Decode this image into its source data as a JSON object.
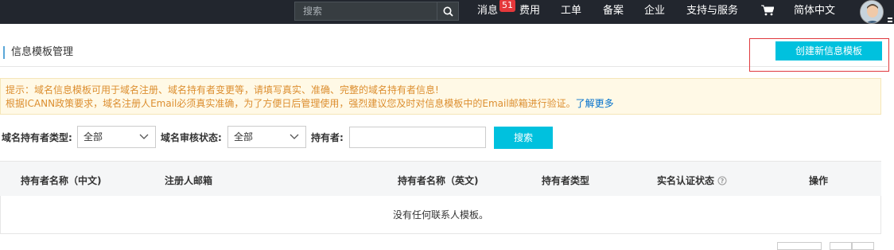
{
  "topbar": {
    "search_placeholder": "搜索",
    "messages_label": "消息",
    "messages_count": "51",
    "nav": [
      "费用",
      "工单",
      "备案",
      "企业",
      "支持与服务"
    ],
    "language": "简体中文"
  },
  "page": {
    "title": "信息模板管理",
    "create_button": "创建新信息模板"
  },
  "notice": {
    "line1": "提示：域名信息模板可用于域名注册、域名持有者变更等，请填写真实、准确、完整的域名持有者信息!",
    "line2": "根据ICANN政策要求，域名注册人Email必须真实准确，为了方便日后管理使用，强烈建议您及时对信息模板中的Email邮箱进行验证。",
    "link": "了解更多"
  },
  "filters": {
    "holder_type_label": "域名持有者类型:",
    "holder_type_value": "全部",
    "audit_status_label": "域名审核状态:",
    "audit_status_value": "全部",
    "holder_label": "持有者:",
    "holder_value": "",
    "search_button": "搜索"
  },
  "table": {
    "columns": [
      "持有者名称（中文)",
      "注册人邮箱",
      "持有者名称（英文)",
      "持有者类型",
      "实名认证状态",
      "操作"
    ],
    "empty_text": "没有任何联系人模板。"
  }
}
